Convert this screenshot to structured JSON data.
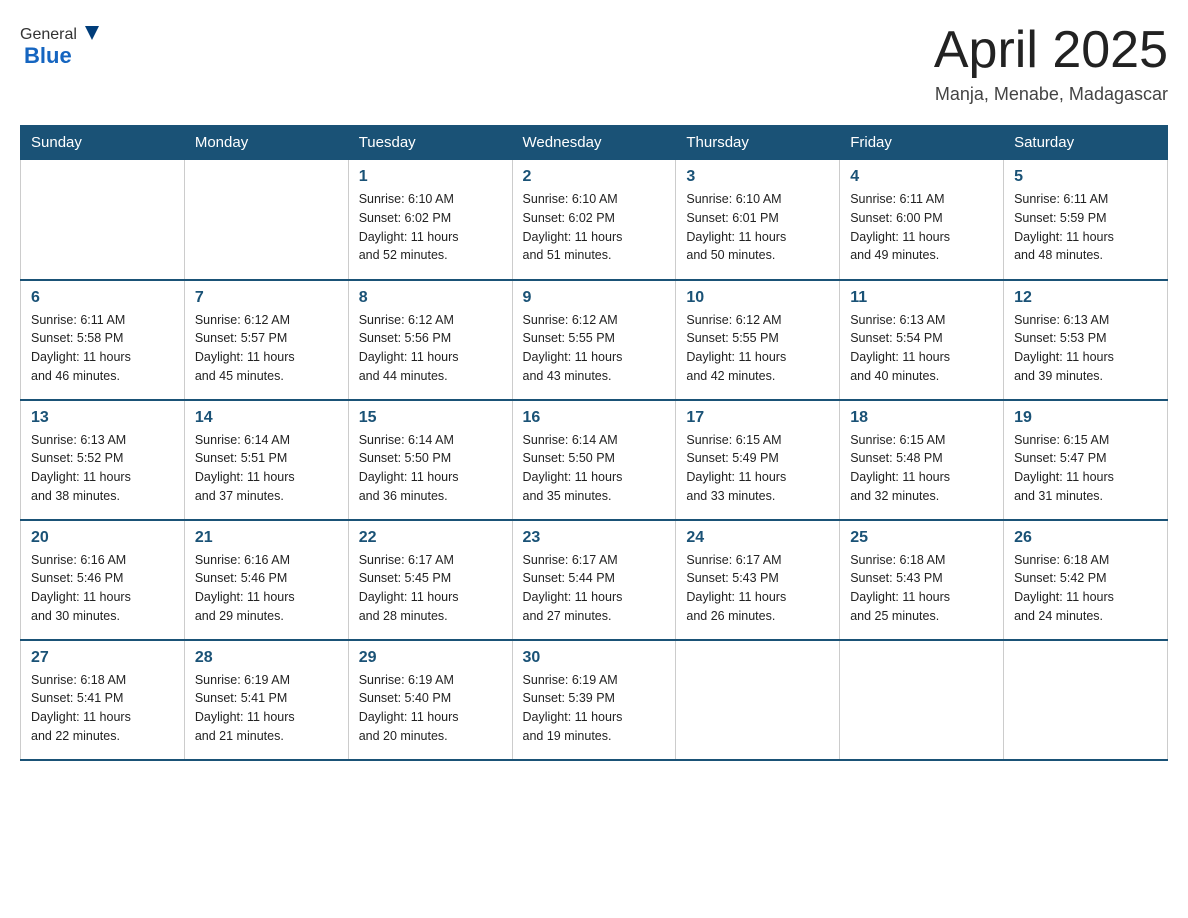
{
  "logo": {
    "general": "General",
    "arrow": "▶",
    "blue": "Blue"
  },
  "title": "April 2025",
  "location": "Manja, Menabe, Madagascar",
  "days_of_week": [
    "Sunday",
    "Monday",
    "Tuesday",
    "Wednesday",
    "Thursday",
    "Friday",
    "Saturday"
  ],
  "weeks": [
    [
      {
        "day": "",
        "info": ""
      },
      {
        "day": "",
        "info": ""
      },
      {
        "day": "1",
        "info": "Sunrise: 6:10 AM\nSunset: 6:02 PM\nDaylight: 11 hours\nand 52 minutes."
      },
      {
        "day": "2",
        "info": "Sunrise: 6:10 AM\nSunset: 6:02 PM\nDaylight: 11 hours\nand 51 minutes."
      },
      {
        "day": "3",
        "info": "Sunrise: 6:10 AM\nSunset: 6:01 PM\nDaylight: 11 hours\nand 50 minutes."
      },
      {
        "day": "4",
        "info": "Sunrise: 6:11 AM\nSunset: 6:00 PM\nDaylight: 11 hours\nand 49 minutes."
      },
      {
        "day": "5",
        "info": "Sunrise: 6:11 AM\nSunset: 5:59 PM\nDaylight: 11 hours\nand 48 minutes."
      }
    ],
    [
      {
        "day": "6",
        "info": "Sunrise: 6:11 AM\nSunset: 5:58 PM\nDaylight: 11 hours\nand 46 minutes."
      },
      {
        "day": "7",
        "info": "Sunrise: 6:12 AM\nSunset: 5:57 PM\nDaylight: 11 hours\nand 45 minutes."
      },
      {
        "day": "8",
        "info": "Sunrise: 6:12 AM\nSunset: 5:56 PM\nDaylight: 11 hours\nand 44 minutes."
      },
      {
        "day": "9",
        "info": "Sunrise: 6:12 AM\nSunset: 5:55 PM\nDaylight: 11 hours\nand 43 minutes."
      },
      {
        "day": "10",
        "info": "Sunrise: 6:12 AM\nSunset: 5:55 PM\nDaylight: 11 hours\nand 42 minutes."
      },
      {
        "day": "11",
        "info": "Sunrise: 6:13 AM\nSunset: 5:54 PM\nDaylight: 11 hours\nand 40 minutes."
      },
      {
        "day": "12",
        "info": "Sunrise: 6:13 AM\nSunset: 5:53 PM\nDaylight: 11 hours\nand 39 minutes."
      }
    ],
    [
      {
        "day": "13",
        "info": "Sunrise: 6:13 AM\nSunset: 5:52 PM\nDaylight: 11 hours\nand 38 minutes."
      },
      {
        "day": "14",
        "info": "Sunrise: 6:14 AM\nSunset: 5:51 PM\nDaylight: 11 hours\nand 37 minutes."
      },
      {
        "day": "15",
        "info": "Sunrise: 6:14 AM\nSunset: 5:50 PM\nDaylight: 11 hours\nand 36 minutes."
      },
      {
        "day": "16",
        "info": "Sunrise: 6:14 AM\nSunset: 5:50 PM\nDaylight: 11 hours\nand 35 minutes."
      },
      {
        "day": "17",
        "info": "Sunrise: 6:15 AM\nSunset: 5:49 PM\nDaylight: 11 hours\nand 33 minutes."
      },
      {
        "day": "18",
        "info": "Sunrise: 6:15 AM\nSunset: 5:48 PM\nDaylight: 11 hours\nand 32 minutes."
      },
      {
        "day": "19",
        "info": "Sunrise: 6:15 AM\nSunset: 5:47 PM\nDaylight: 11 hours\nand 31 minutes."
      }
    ],
    [
      {
        "day": "20",
        "info": "Sunrise: 6:16 AM\nSunset: 5:46 PM\nDaylight: 11 hours\nand 30 minutes."
      },
      {
        "day": "21",
        "info": "Sunrise: 6:16 AM\nSunset: 5:46 PM\nDaylight: 11 hours\nand 29 minutes."
      },
      {
        "day": "22",
        "info": "Sunrise: 6:17 AM\nSunset: 5:45 PM\nDaylight: 11 hours\nand 28 minutes."
      },
      {
        "day": "23",
        "info": "Sunrise: 6:17 AM\nSunset: 5:44 PM\nDaylight: 11 hours\nand 27 minutes."
      },
      {
        "day": "24",
        "info": "Sunrise: 6:17 AM\nSunset: 5:43 PM\nDaylight: 11 hours\nand 26 minutes."
      },
      {
        "day": "25",
        "info": "Sunrise: 6:18 AM\nSunset: 5:43 PM\nDaylight: 11 hours\nand 25 minutes."
      },
      {
        "day": "26",
        "info": "Sunrise: 6:18 AM\nSunset: 5:42 PM\nDaylight: 11 hours\nand 24 minutes."
      }
    ],
    [
      {
        "day": "27",
        "info": "Sunrise: 6:18 AM\nSunset: 5:41 PM\nDaylight: 11 hours\nand 22 minutes."
      },
      {
        "day": "28",
        "info": "Sunrise: 6:19 AM\nSunset: 5:41 PM\nDaylight: 11 hours\nand 21 minutes."
      },
      {
        "day": "29",
        "info": "Sunrise: 6:19 AM\nSunset: 5:40 PM\nDaylight: 11 hours\nand 20 minutes."
      },
      {
        "day": "30",
        "info": "Sunrise: 6:19 AM\nSunset: 5:39 PM\nDaylight: 11 hours\nand 19 minutes."
      },
      {
        "day": "",
        "info": ""
      },
      {
        "day": "",
        "info": ""
      },
      {
        "day": "",
        "info": ""
      }
    ]
  ]
}
